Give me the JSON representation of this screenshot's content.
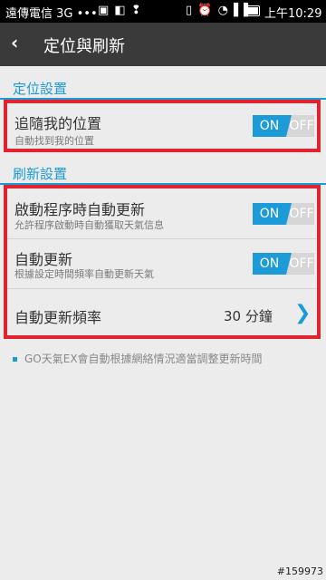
{
  "status_bar": {
    "carrier": "遠傳電信 3G •••",
    "icons_left": "▣ ◧ ❢",
    "icons_right": "▯ ⏰ ◔ ▌▌",
    "time": "上午10:29"
  },
  "header": {
    "back_icon": "‹",
    "title": "定位與刷新"
  },
  "sections": {
    "location": {
      "title": "定位設置",
      "follow": {
        "label": "追隨我的位置",
        "sub": "自動找到我的位置",
        "on": "ON",
        "off": "OFF"
      }
    },
    "refresh": {
      "title": "刷新設置",
      "startup": {
        "label": "啟動程序時自動更新",
        "sub": "允許程序啟動時自動獲取天氣信息",
        "on": "ON",
        "off": "OFF"
      },
      "auto": {
        "label": "自動更新",
        "sub": "根據設定時間頻率自動更新天氣",
        "on": "ON",
        "off": "OFF"
      },
      "frequency": {
        "label": "自動更新頻率",
        "value": "30 分鐘",
        "chevron": "❯"
      }
    }
  },
  "note": "GO天氣EX會自動根據網絡情況適當調整更新時間",
  "watermark": "#159973",
  "colors": {
    "accent": "#1a9ad6",
    "highlight": "#e0232e",
    "toggle_on": "#1d9bd8",
    "header": "#3a3a3a"
  }
}
